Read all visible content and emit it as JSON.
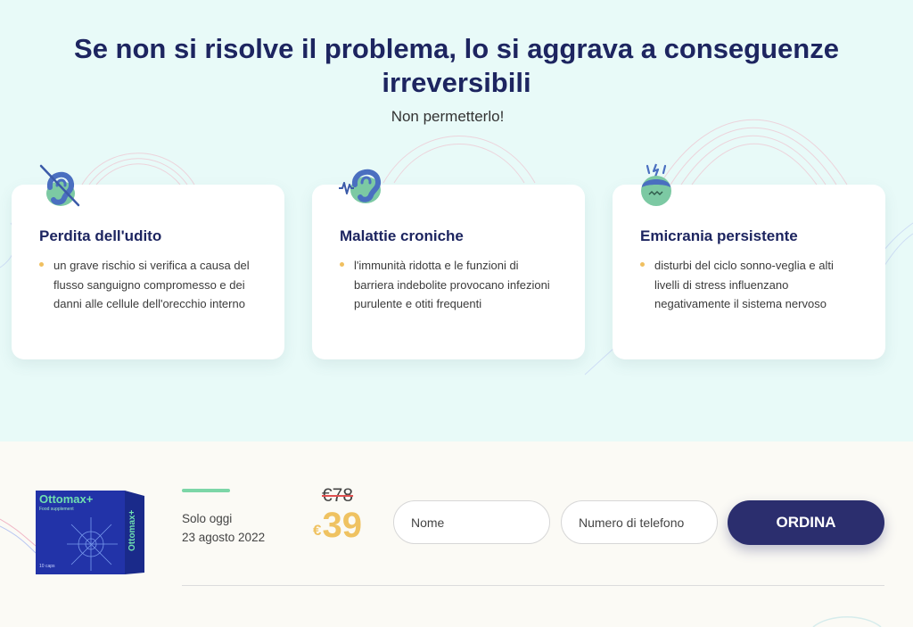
{
  "header": {
    "title": "Se non si risolve il problema, lo si aggrava a conseguenze irreversibili",
    "subtitle": "Non permetterlo!"
  },
  "cards": [
    {
      "title": "Perdita dell'udito",
      "text": "un grave rischio si verifica a causa del flusso sanguigno compromesso e dei danni alle cellule dell'orecchio interno",
      "icon": "crossed-ear-icon"
    },
    {
      "title": "Malattie croniche",
      "text": "l'immunità ridotta e le funzioni di barriera indebolite provocano infezioni purulente e otiti frequenti",
      "icon": "ear-sound-icon"
    },
    {
      "title": "Emicrania persistente",
      "text": "disturbi del ciclo sonno-veglia e alti livelli di stress influenzano negativamente il sistema nervoso",
      "icon": "headache-head-icon"
    }
  ],
  "order": {
    "product_name": "Ottomax+",
    "product_tag": "Food supplement",
    "product_count": "10 caps",
    "label": "Solo oggi",
    "date": "23 agosto 2022",
    "old_price": "€78",
    "currency": "€",
    "new_price": "39",
    "name_placeholder": "Nome",
    "phone_placeholder": "Numero di telefono",
    "button_label": "ORDINA"
  },
  "colors": {
    "navy": "#1d2560",
    "button": "#2b2e6e",
    "accent_gold": "#efc261",
    "accent_green": "#7cd6a7",
    "top_bg": "#e8faf8"
  }
}
